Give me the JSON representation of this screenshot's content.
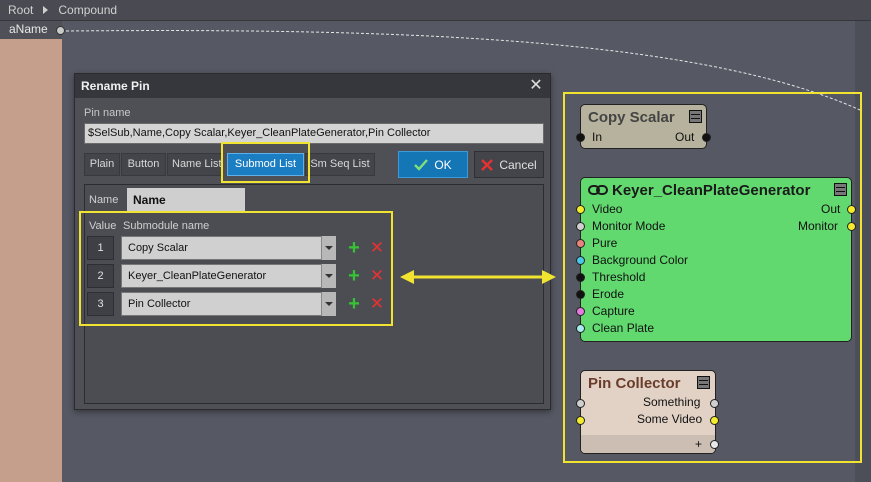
{
  "breadcrumb": {
    "root": "Root",
    "current": "Compound"
  },
  "left_input": {
    "label": "aName"
  },
  "dialog": {
    "title": "Rename Pin",
    "close": "✕",
    "pin_name_label": "Pin name",
    "pin_name_value": "$SelSub,Name,Copy Scalar,Keyer_CleanPlateGenerator,Pin Collector",
    "tabs": [
      "Plain",
      "Button",
      "Name List",
      "Submod List",
      "Sm Seq List"
    ],
    "active_tab": "Submod List",
    "ok_label": "OK",
    "cancel_label": "Cancel",
    "name_label": "Name",
    "name_value": "Name",
    "columns": {
      "value": "Value",
      "submodule": "Submodule name"
    },
    "rows": [
      {
        "index": "1",
        "submodule": "Copy Scalar"
      },
      {
        "index": "2",
        "submodule": "Keyer_CleanPlateGenerator"
      },
      {
        "index": "3",
        "submodule": "Pin Collector"
      }
    ],
    "add_glyph": "+",
    "delete_glyph": "✕"
  },
  "nodes": {
    "copy_scalar": {
      "title": "Copy Scalar",
      "in": "In",
      "out": "Out",
      "color": "#b7b29d"
    },
    "keyer": {
      "title": "Keyer_CleanPlateGenerator",
      "color": "#61d96f",
      "inputs": [
        {
          "label": "Video",
          "pin_color": "#f2ec2c"
        },
        {
          "label": "Monitor Mode",
          "pin_color": "#cfcfcf"
        },
        {
          "label": "Pure",
          "pin_color": "#e8847c"
        },
        {
          "label": "Background Color",
          "pin_color": "#4cc6e6"
        },
        {
          "label": "Threshold",
          "pin_color": "#111111"
        },
        {
          "label": "Erode",
          "pin_color": "#111111"
        },
        {
          "label": "Capture",
          "pin_color": "#e47ae0"
        },
        {
          "label": "Clean Plate",
          "pin_color": "#a8ecf0"
        }
      ],
      "outputs": [
        {
          "label": "Out",
          "pin_color": "#f2ec2c"
        },
        {
          "label": "Monitor",
          "pin_color": "#f2ec2c"
        }
      ]
    },
    "pin_collector": {
      "title": "Pin Collector",
      "color": "#e2d2c6",
      "outputs": [
        {
          "label": "Something",
          "pin_color": "#cfcfcf"
        },
        {
          "label": "Some Video",
          "pin_color": "#f2ec2c"
        }
      ],
      "add_label": "+"
    }
  },
  "colors": {
    "highlight": "#f0e431",
    "accent": "#1c7ec2"
  }
}
